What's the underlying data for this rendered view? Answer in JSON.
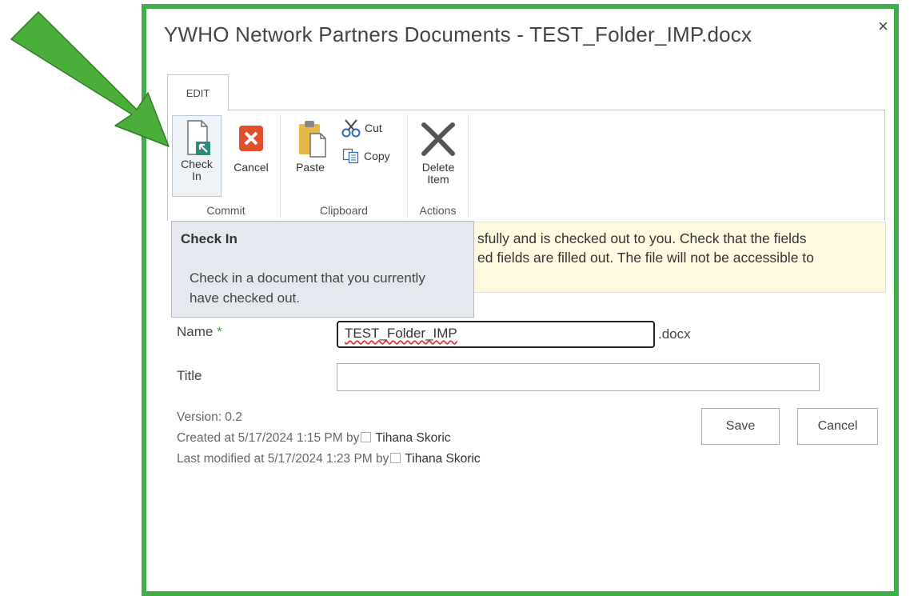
{
  "dialog": {
    "title": "YWHO Network Partners Documents - TEST_Folder_IMP.docx",
    "close_glyph": "×"
  },
  "ribbon": {
    "tab": "EDIT",
    "groups": [
      {
        "label": "Commit"
      },
      {
        "label": "Clipboard"
      },
      {
        "label": "Actions"
      }
    ],
    "buttons": {
      "check_in_1": "Check",
      "check_in_2": "In",
      "cancel": "Cancel",
      "paste": "Paste",
      "cut": "Cut",
      "copy": "Copy",
      "delete_1": "Delete",
      "delete_2": "Item"
    }
  },
  "notice": {
    "line1": "sfully and is checked out to you. Check that the fields",
    "line2": "ed fields are filled out. The file will not be accessible to"
  },
  "tooltip": {
    "title": "Check In",
    "body": "Check in a document that you currently have checked out."
  },
  "form": {
    "name_label": "Name",
    "required_mark": "*",
    "name_value": "TEST_Folder_IMP",
    "name_ext": ".docx",
    "title_label": "Title",
    "title_value": ""
  },
  "meta": {
    "version": "Version: 0.2",
    "created_prefix": "Created at 5/17/2024 1:15 PM  by",
    "created_user": "Tihana Skoric",
    "modified_prefix": "Last modified at 5/17/2024 1:23 PM  by",
    "modified_user": "Tihana Skoric"
  },
  "actions": {
    "save": "Save",
    "cancel": "Cancel"
  },
  "colors": {
    "frame_green": "#3fae49",
    "arrow_green": "#4cae3a",
    "cancel_red": "#e0502a",
    "notice_bg": "#fff9e0"
  }
}
